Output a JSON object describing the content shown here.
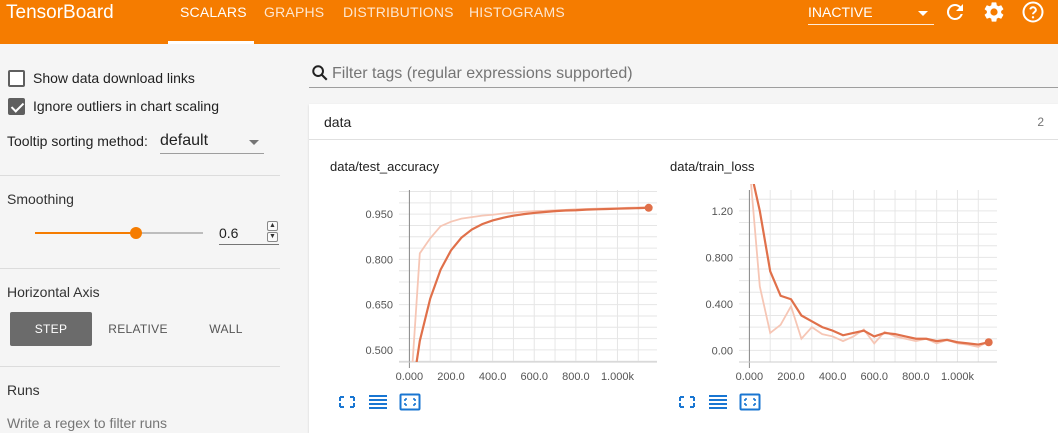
{
  "header": {
    "brand": "TensorBoard",
    "tabs": [
      "SCALARS",
      "GRAPHS",
      "DISTRIBUTIONS",
      "HISTOGRAMS"
    ],
    "active_tab": "SCALARS",
    "status_select": "INACTIVE",
    "icons": [
      "refresh-icon",
      "settings-icon",
      "help-icon"
    ]
  },
  "sidebar": {
    "show_download_label": "Show data download links",
    "show_download_checked": false,
    "ignore_outliers_label": "Ignore outliers in chart scaling",
    "ignore_outliers_checked": true,
    "tooltip_label": "Tooltip sorting method:",
    "tooltip_value": "default",
    "smoothing_title": "Smoothing",
    "smoothing_value": "0.6",
    "smoothing_fraction": 0.6,
    "horizontal_axis_title": "Horizontal Axis",
    "axis_options": [
      "STEP",
      "RELATIVE",
      "WALL"
    ],
    "axis_selected": "STEP",
    "runs_title": "Runs",
    "runs_placeholder": "Write a regex to filter runs"
  },
  "filter": {
    "placeholder": "Filter tags (regular expressions supported)"
  },
  "panel": {
    "title": "data",
    "count": "2"
  },
  "colors": {
    "accent": "#f57c00",
    "series_smoothed": "#e0704a",
    "series_raw": "#f6c6b5"
  },
  "chart_data": [
    {
      "type": "line",
      "title": "data/test_accuracy",
      "xlabel": "",
      "ylabel": "",
      "xlim": [
        -50,
        1190
      ],
      "ylim": [
        0.46,
        1.03
      ],
      "x_ticks": [
        0,
        200,
        400,
        600,
        800,
        1000
      ],
      "x_tick_labels": [
        "0.000",
        "200.0",
        "400.0",
        "600.0",
        "800.0",
        "1.000k"
      ],
      "y_ticks": [
        0.5,
        0.65,
        0.8,
        0.95
      ],
      "y_tick_labels": [
        "0.500",
        "0.650",
        "0.800",
        "0.950"
      ],
      "grid": true,
      "series": [
        {
          "role": "raw",
          "x": [
            0,
            50,
            100,
            150,
            200,
            250,
            300,
            350,
            400,
            450,
            500,
            550,
            600,
            650,
            700,
            750,
            800,
            850,
            900,
            950,
            1000,
            1050,
            1100,
            1150
          ],
          "y": [
            0.3,
            0.82,
            0.87,
            0.91,
            0.925,
            0.935,
            0.94,
            0.945,
            0.948,
            0.952,
            0.955,
            0.958,
            0.96,
            0.961,
            0.963,
            0.964,
            0.966,
            0.967,
            0.968,
            0.969,
            0.97,
            0.971,
            0.972,
            0.973
          ]
        },
        {
          "role": "smoothed",
          "x": [
            0,
            50,
            100,
            150,
            200,
            250,
            300,
            350,
            400,
            450,
            500,
            550,
            600,
            650,
            700,
            750,
            800,
            850,
            900,
            950,
            1000,
            1050,
            1100,
            1150
          ],
          "y": [
            0.3,
            0.53,
            0.67,
            0.766,
            0.83,
            0.872,
            0.899,
            0.917,
            0.929,
            0.938,
            0.945,
            0.95,
            0.954,
            0.957,
            0.96,
            0.962,
            0.963,
            0.965,
            0.966,
            0.967,
            0.968,
            0.969,
            0.97,
            0.971
          ]
        }
      ]
    },
    {
      "type": "line",
      "title": "data/train_loss",
      "xlabel": "",
      "ylabel": "",
      "xlim": [
        -50,
        1190
      ],
      "ylim": [
        -0.1,
        1.38
      ],
      "x_ticks": [
        0,
        200,
        400,
        600,
        800,
        1000
      ],
      "x_tick_labels": [
        "0.000",
        "200.0",
        "400.0",
        "600.0",
        "800.0",
        "1.000k"
      ],
      "y_ticks": [
        0,
        0.4,
        0.8,
        1.2
      ],
      "y_tick_labels": [
        "0.00",
        "0.400",
        "0.800",
        "1.20"
      ],
      "grid": true,
      "series": [
        {
          "role": "raw",
          "x": [
            0,
            50,
            100,
            150,
            200,
            250,
            300,
            350,
            400,
            450,
            500,
            550,
            600,
            650,
            700,
            750,
            800,
            850,
            900,
            950,
            1000,
            1050,
            1100,
            1150
          ],
          "y": [
            1.6,
            0.55,
            0.15,
            0.22,
            0.38,
            0.1,
            0.2,
            0.14,
            0.12,
            0.08,
            0.12,
            0.18,
            0.06,
            0.16,
            0.12,
            0.1,
            0.08,
            0.1,
            0.06,
            0.09,
            0.06,
            0.05,
            0.03,
            0.08
          ]
        },
        {
          "role": "smoothed",
          "x": [
            0,
            50,
            100,
            150,
            200,
            250,
            300,
            350,
            400,
            450,
            500,
            550,
            600,
            650,
            700,
            750,
            800,
            850,
            900,
            950,
            1000,
            1050,
            1100,
            1150
          ],
          "y": [
            1.6,
            1.2,
            0.68,
            0.47,
            0.44,
            0.3,
            0.25,
            0.2,
            0.17,
            0.13,
            0.15,
            0.17,
            0.12,
            0.15,
            0.14,
            0.12,
            0.1,
            0.1,
            0.08,
            0.09,
            0.07,
            0.06,
            0.05,
            0.07
          ]
        }
      ]
    }
  ]
}
